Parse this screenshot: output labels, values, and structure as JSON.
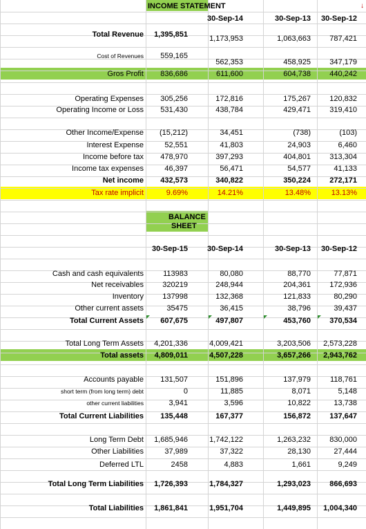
{
  "income": {
    "title": "INCOME STATEMENT",
    "periods": [
      "30-Sep-14",
      "30-Sep-13",
      "30-Sep-12"
    ],
    "total_revenue": {
      "label": "Total Revenue",
      "v0": "1,395,851",
      "v1": "1,173,953",
      "v2": "1,063,663",
      "v3": "787,421"
    },
    "cost_of_revenues": {
      "label": "Cost of Revenues",
      "v0": "559,165",
      "v1": "562,353",
      "v2": "458,925",
      "v3": "347,179"
    },
    "gros_profit": {
      "label": "Gros Profit",
      "v0": "836,686",
      "v1": "611,600",
      "v2": "604,738",
      "v3": "440,242"
    },
    "operating_expenses": {
      "label": "Operating Expenses",
      "v0": "305,256",
      "v1": "172,816",
      "v2": "175,267",
      "v3": "120,832"
    },
    "operating_income": {
      "label": "Operating Income or Loss",
      "v0": "531,430",
      "v1": "438,784",
      "v2": "429,471",
      "v3": "319,410"
    },
    "other_income": {
      "label": "Other Income/Expense",
      "v0": "(15,212)",
      "v1": "34,451",
      "v2": "(738)",
      "v3": "(103)"
    },
    "interest_expense": {
      "label": "Interest Expense",
      "v0": "52,551",
      "v1": "41,803",
      "v2": "24,903",
      "v3": "6,460"
    },
    "income_before_tax": {
      "label": "Income before tax",
      "v0": "478,970",
      "v1": "397,293",
      "v2": "404,801",
      "v3": "313,304"
    },
    "income_tax": {
      "label": "Income tax expenses",
      "v0": "46,397",
      "v1": "56,471",
      "v2": "54,577",
      "v3": "41,133"
    },
    "net_income": {
      "label": "Net income",
      "v0": "432,573",
      "v1": "340,822",
      "v2": "350,224",
      "v3": "272,171"
    },
    "tax_rate": {
      "label": "Tax rate implicit",
      "v0": "9.69%",
      "v1": "14.21%",
      "v2": "13.48%",
      "v3": "13.13%"
    }
  },
  "balance": {
    "title_line1": "BALANCE",
    "title_line2": "SHEET",
    "periods": [
      "30-Sep-15",
      "30-Sep-14",
      "30-Sep-13",
      "30-Sep-12"
    ],
    "cash": {
      "label": "Cash and cash equivalents",
      "v0": "113983",
      "v1": "80,080",
      "v2": "88,770",
      "v3": "77,871"
    },
    "receivables": {
      "label": "Net receivables",
      "v0": "320219",
      "v1": "248,944",
      "v2": "204,361",
      "v3": "172,936"
    },
    "inventory": {
      "label": "Inventory",
      "v0": "137998",
      "v1": "132,368",
      "v2": "121,833",
      "v3": "80,290"
    },
    "other_current_assets": {
      "label": "Other current assets",
      "v0": "35475",
      "v1": "36,415",
      "v2": "38,796",
      "v3": "39,437"
    },
    "total_current_assets": {
      "label": "Total Current Assets",
      "v0": "607,675",
      "v1": "497,807",
      "v2": "453,760",
      "v3": "370,534"
    },
    "total_long_term_assets": {
      "label": "Total Long Term Assets",
      "v0": "4,201,336",
      "v1": "4,009,421",
      "v2": "3,203,506",
      "v3": "2,573,228"
    },
    "total_assets": {
      "label": "Total assets",
      "v0": "4,809,011",
      "v1": "4,507,228",
      "v2": "3,657,266",
      "v3": "2,943,762"
    },
    "accounts_payable": {
      "label": "Accounts payable",
      "v0": "131,507",
      "v1": "151,896",
      "v2": "137,979",
      "v3": "118,761"
    },
    "short_term_debt": {
      "label": "short term (from long term) debt",
      "v0": "0",
      "v1": "11,885",
      "v2": "8,071",
      "v3": "5,148"
    },
    "other_current_liabilities": {
      "label": "other current liabilities",
      "v0": "3,941",
      "v1": "3,596",
      "v2": "10,822",
      "v3": "13,738"
    },
    "total_current_liabilities": {
      "label": "Total Current Liabilities",
      "v0": "135,448",
      "v1": "167,377",
      "v2": "156,872",
      "v3": "137,647"
    },
    "long_term_debt": {
      "label": "Long Term Debt",
      "v0": "1,685,946",
      "v1": "1,742,122",
      "v2": "1,263,232",
      "v3": "830,000"
    },
    "other_liabilities": {
      "label": "Other Liabilities",
      "v0": "37,989",
      "v1": "37,322",
      "v2": "28,130",
      "v3": "27,444"
    },
    "deferred_ltl": {
      "label": "Deferred LTL",
      "v0": "2458",
      "v1": "4,883",
      "v2": "1,661",
      "v3": "9,249"
    },
    "total_long_term_liabilities": {
      "label": "Total Long Term Liabilities",
      "v0": "1,726,393",
      "v1": "1,784,327",
      "v2": "1,293,023",
      "v3": "866,693"
    },
    "total_liabilities": {
      "label": "Total Liabilities",
      "v0": "1,861,841",
      "v1": "1,951,704",
      "v2": "1,449,895",
      "v3": "1,004,340"
    }
  },
  "colors": {
    "highlight_green": "#92d050",
    "highlight_yellow": "#ffff00",
    "gridline": "#d4d4d4",
    "tax_rate_text": "#c00000"
  },
  "icons": {
    "corner_marker": "down-arrow-icon",
    "cell_note": "green-triangle-icon"
  }
}
